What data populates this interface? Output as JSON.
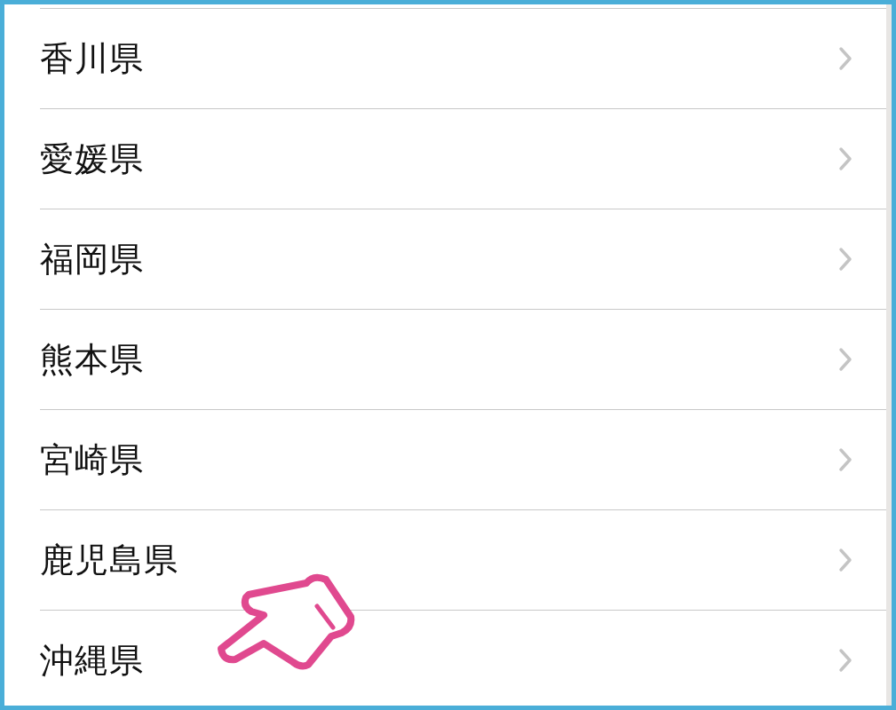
{
  "list": {
    "items": [
      {
        "label": "香川県"
      },
      {
        "label": "愛媛県"
      },
      {
        "label": "福岡県"
      },
      {
        "label": "熊本県"
      },
      {
        "label": "宮崎県"
      },
      {
        "label": "鹿児島県"
      },
      {
        "label": "沖縄県"
      }
    ]
  }
}
